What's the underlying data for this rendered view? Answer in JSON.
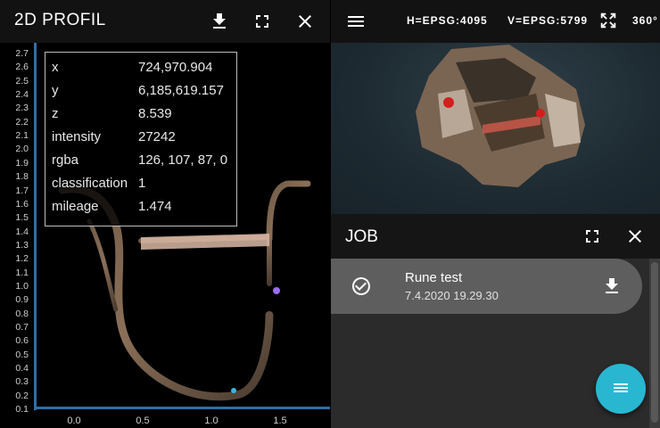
{
  "profile": {
    "title": "2D PROFIL",
    "download_icon": "download-icon",
    "fullscreen_icon": "fullscreen-icon",
    "close_icon": "close-icon",
    "y_ticks": [
      "2.7",
      "2.6",
      "2.5",
      "2.4",
      "2.3",
      "2.2",
      "2.1",
      "2.0",
      "1.9",
      "1.8",
      "1.7",
      "1.6",
      "1.5",
      "1.4",
      "1.3",
      "1.2",
      "1.1",
      "1.0",
      "0.9",
      "0.8",
      "0.7",
      "0.6",
      "0.5",
      "0.4",
      "0.3",
      "0.2",
      "0.1"
    ],
    "x_ticks": [
      "0.0",
      "0.5",
      "1.0",
      "1.5"
    ],
    "axis_color": "#2f6fa8",
    "point_info": [
      {
        "key": "x",
        "value": "724,970.904"
      },
      {
        "key": "y",
        "value": "6,185,619.157"
      },
      {
        "key": "z",
        "value": "8.539"
      },
      {
        "key": "intensity",
        "value": "27242"
      },
      {
        "key": "rgba",
        "value": "126, 107, 87, 0"
      },
      {
        "key": "classification",
        "value": "1"
      },
      {
        "key": "mileage",
        "value": "1.474"
      }
    ]
  },
  "viewer": {
    "menu_icon": "menu-icon",
    "h_crs": "H=EPSG:4095",
    "v_crs": "V=EPSG:5799",
    "expand_icon": "expand-icon",
    "rotation_label": "360°"
  },
  "job": {
    "title": "JOB",
    "fullscreen_icon": "fullscreen-icon",
    "close_icon": "close-icon",
    "items": [
      {
        "name": "Rune test",
        "date": "7.4.2020 19.29.30",
        "status_icon": "check-circle-icon",
        "action_icon": "download-icon"
      }
    ],
    "fab_icon": "list-icon",
    "fab_color": "#29b6d1"
  }
}
